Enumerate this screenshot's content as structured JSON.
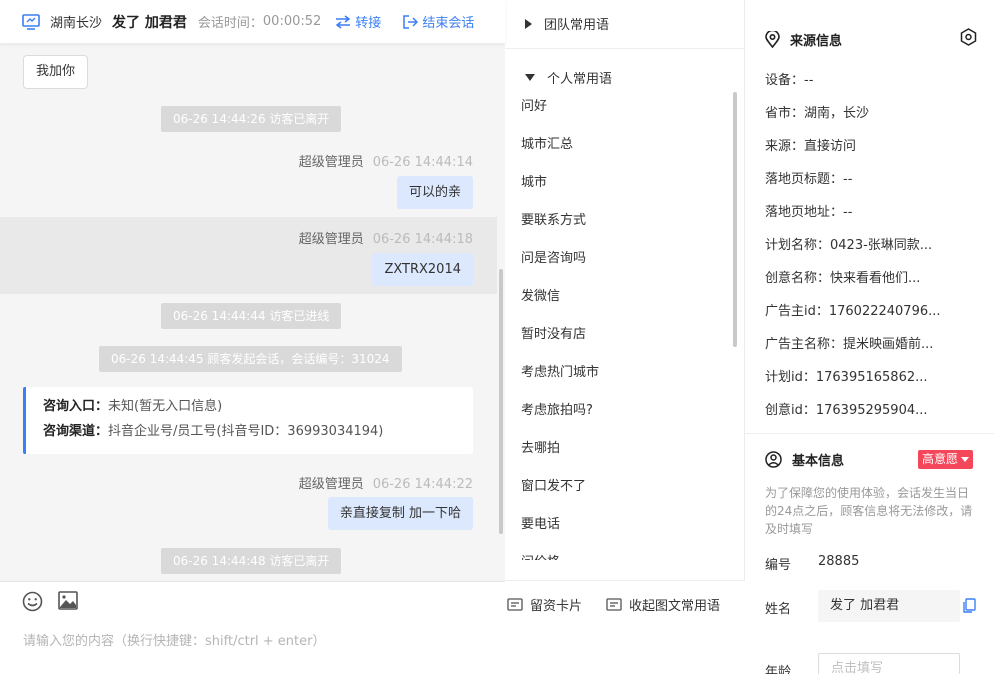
{
  "header": {
    "location": "湖南长沙",
    "visitor_name": "发了 加君君",
    "session_time_label": "会话时间：",
    "session_time": "00:00:52",
    "transfer_label": "转接",
    "end_label": "结束会话"
  },
  "messages": {
    "quick_reply": "我加你",
    "sys_1": "06-26 14:44:26 访客已离开",
    "agent_1": {
      "name": "超级管理员",
      "time": "06-26 14:44:14",
      "text": "可以的亲"
    },
    "agent_2": {
      "name": "超级管理员",
      "time": "06-26 14:44:18",
      "text": "ZXTRX2014"
    },
    "sys_2": "06-26 14:44:44 访客已进线",
    "sys_3": "06-26 14:44:45 顾客发起会话，会话编号：31024",
    "card": {
      "entry_label": "咨询入口：",
      "entry_value": "未知(暂无入口信息)",
      "channel_label": "咨询渠道：",
      "channel_value": "抖音企业号/员工号(抖音号ID：36993034194)"
    },
    "agent_3": {
      "name": "超级管理员",
      "time": "06-26 14:44:22",
      "text": "亲直接复制 加一下哈"
    },
    "sys_4": "06-26 14:44:48 访客已离开"
  },
  "input": {
    "placeholder": "请输入您的内容（换行快捷键：shift/ctrl + enter）"
  },
  "phrases": {
    "team_group": "团队常用语",
    "personal_group": "个人常用语",
    "items": [
      "问好",
      "城市汇总",
      "城市",
      "要联系方式",
      "问是咨询吗",
      "发微信",
      "暂时没有店",
      "考虑热门城市",
      "考虑旅拍吗?",
      "去哪拍",
      "窗口发不了",
      "要电话",
      "问价格"
    ],
    "card_link": "留资卡片",
    "collapse_link": "收起图文常用语"
  },
  "source_info": {
    "title": "来源信息",
    "device": "设备：--",
    "province": "省市：湖南，长沙",
    "source": "来源：直接访问",
    "landing_title": "落地页标题：--",
    "landing_url": "落地页地址：--",
    "plan_name": "计划名称：0423-张琳同款...",
    "creative_name": "创意名称：快来看看他们...",
    "advertiser_id": "广告主id：176022240796...",
    "advertiser_name": "广告主名称：提米映画婚前...",
    "plan_id": "计划id：176395165862...",
    "creative_id": "创意id：176395295904..."
  },
  "basic_info": {
    "title": "基本信息",
    "intent_badge": "高意愿",
    "notice": "为了保障您的使用体验，会话发生当日的24点之后，顾客信息将无法修改，请及时填写",
    "number_label": "编号",
    "number_value": "28885",
    "name_label": "姓名",
    "name_value": "发了 加君君",
    "age_label": "年龄",
    "age_placeholder": "点击填写"
  },
  "colors": {
    "accent": "#3a7ff6",
    "bubble": "#dbe8fd",
    "badge": "#f5475a",
    "system_msg": "#d9d9d9"
  },
  "icons": {
    "header": "monitor-icon",
    "transfer": "swap-arrows-icon",
    "end": "exit-icon",
    "emoji": "emoji-icon",
    "image": "image-icon",
    "card": "message-card-icon",
    "collapse": "message-list-icon",
    "source": "location-pin-icon",
    "settings": "hexagon-gear-icon",
    "basic": "user-circle-icon",
    "copy": "copy-icon"
  }
}
